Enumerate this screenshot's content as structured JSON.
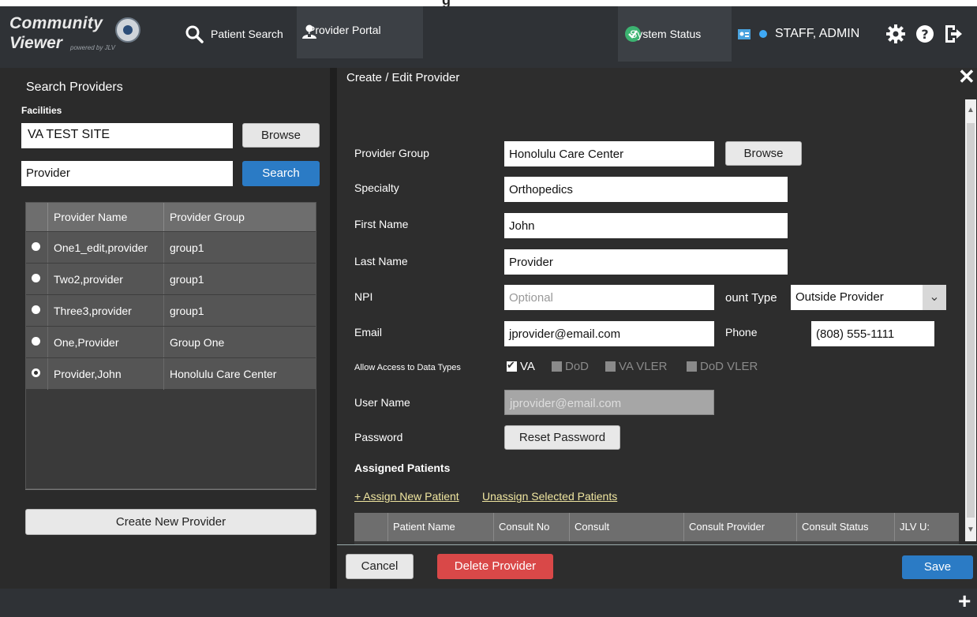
{
  "top_title_fragment": "g",
  "header": {
    "logo_line1": "Community",
    "logo_line2": "Viewer",
    "logo_powered": "powered by JLV",
    "nav_patient_search": "Patient Search",
    "nav_provider_portal": "Provider Portal",
    "system_status": "System Status",
    "user_name": "STAFF, ADMIN",
    "status_color": "#3cb371",
    "accent_color": "#3fa9f5"
  },
  "left_panel": {
    "title": "Search Providers",
    "facilities_label": "Facilities",
    "facilities_value": "VA TEST SITE",
    "browse_label": "Browse",
    "provider_search_value": "Provider",
    "search_label": "Search",
    "table_headers": [
      "Provider Name",
      "Provider Group"
    ],
    "rows": [
      {
        "name": "One1_edit,provider",
        "group": "group1",
        "selected": false
      },
      {
        "name": "Two2,provider",
        "group": "group1",
        "selected": false
      },
      {
        "name": "Three3,provider",
        "group": "group1",
        "selected": false
      },
      {
        "name": "One,Provider",
        "group": "Group One",
        "selected": false
      },
      {
        "name": "Provider,John",
        "group": "Honolulu Care Center",
        "selected": true
      }
    ],
    "create_label": "Create New Provider"
  },
  "right_panel": {
    "title": "Create / Edit Provider",
    "provider_group_label": "Provider Group",
    "provider_group_value": "Honolulu Care Center",
    "browse_label": "Browse",
    "specialty_label": "Specialty",
    "specialty_value": "Orthopedics",
    "first_name_label": "First Name",
    "first_name_value": "John",
    "last_name_label": "Last Name",
    "last_name_value": "Provider",
    "npi_label": "NPI",
    "npi_placeholder": "Optional",
    "account_type_label": "ount Type",
    "account_type_value": "Outside Provider",
    "email_label": "Email",
    "email_value": "jprovider@email.com",
    "phone_label": "Phone",
    "phone_value": "(808) 555-1111",
    "access_label": "Allow Access to Data Types",
    "data_types": [
      {
        "label": "VA",
        "checked": true
      },
      {
        "label": "DoD",
        "checked": false
      },
      {
        "label": "VA VLER",
        "checked": false
      },
      {
        "label": "DoD VLER",
        "checked": false
      }
    ],
    "username_label": "User Name",
    "username_value": "jprovider@email.com",
    "password_label": "Password",
    "reset_password_label": "Reset Password",
    "assigned_patients_label": "Assigned Patients",
    "assign_link": "+ Assign New Patient",
    "unassign_link": "Unassign Selected Patients",
    "table_headers": [
      "Patient Name",
      "Consult No",
      "Consult",
      "Consult Provider",
      "Consult Status",
      "JLV U:"
    ],
    "cancel_label": "Cancel",
    "delete_label": "Delete Provider",
    "save_label": "Save"
  }
}
